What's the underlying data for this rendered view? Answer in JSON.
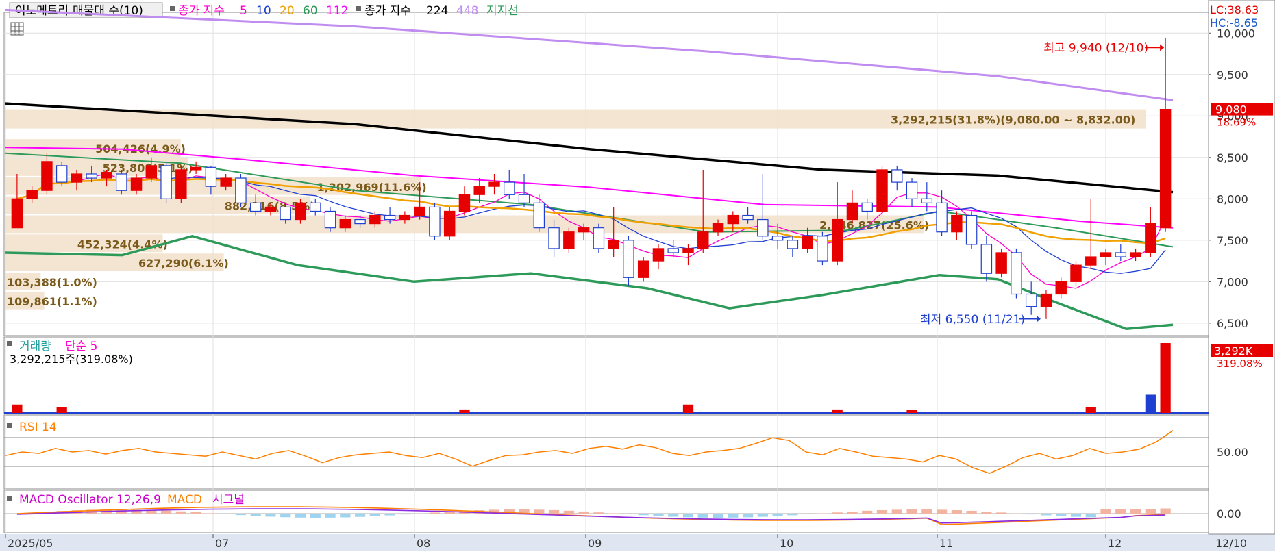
{
  "chart_data": {
    "type": "candlestick",
    "title": "이노메트리",
    "x_dates": [
      "2025/05",
      "07",
      "08",
      "09",
      "10",
      "11",
      "12"
    ],
    "x_current_label": "12/10",
    "legend_main": {
      "volume_profile": "매물대 수(10)",
      "ma_prefix": "종가 지수",
      "ma_periods": [
        "5",
        "10",
        "20",
        "60",
        "112"
      ],
      "ma_long_prefix": "종가 지수",
      "ma_long_periods": [
        "224",
        "448"
      ],
      "support_label": "지지선"
    },
    "lc_label": "LC:38.63",
    "hc_label": "HC:-8.65",
    "price_axis": {
      "min": 6350,
      "max": 10250,
      "ticks": [
        10000,
        9500,
        9000,
        8500,
        8000,
        7500,
        7000,
        6500
      ],
      "tick_labels": [
        "10,000",
        "9,500",
        "9,000",
        "8,500",
        "8,000",
        "7,500",
        "7,000",
        "6,500"
      ]
    },
    "current_price": {
      "value": 9080,
      "label": "9,080",
      "change_label": "18.69%"
    },
    "high_annotation": "최고 9,940 (12/10)",
    "low_annotation": "최저 6,550 (11/21)",
    "volume_profile": [
      {
        "label": "3,292,215(31.8%)(9,080.00 ~ 8,832.00)",
        "price_low": 8832,
        "price_high": 9080,
        "pct": 31.8
      },
      {
        "label": "504,426(4.9%)",
        "price_low": 8490,
        "price_high": 8720,
        "pct": 4.9
      },
      {
        "label": "523,808(5.1%)",
        "price_low": 8260,
        "price_high": 8490,
        "pct": 5.1
      },
      {
        "label": "1,202,969(11.6%)",
        "price_low": 8030,
        "price_high": 8260,
        "pct": 11.6
      },
      {
        "label": "882,116(8.5%)",
        "price_low": 7800,
        "price_high": 8030,
        "pct": 8.5
      },
      {
        "label": "2,646,827(25.6%)",
        "price_low": 7570,
        "price_high": 7800,
        "pct": 25.6
      },
      {
        "label": "452,324(4.4%)",
        "price_low": 7340,
        "price_high": 7570,
        "pct": 4.4
      },
      {
        "label": "627,290(6.1%)",
        "price_low": 7110,
        "price_high": 7340,
        "pct": 6.1
      },
      {
        "label": "103,388(1.0%)",
        "price_low": 6880,
        "price_high": 7110,
        "pct": 1.0
      },
      {
        "label": "109,861(1.1%)",
        "price_low": 6650,
        "price_high": 6880,
        "pct": 1.1
      }
    ],
    "ma_series": [
      {
        "name": "448",
        "color": "#c08cf0",
        "points": [
          [
            0,
            10280
          ],
          [
            0.3,
            10080
          ],
          [
            0.6,
            9780
          ],
          [
            0.85,
            9480
          ],
          [
            1,
            9190
          ]
        ]
      },
      {
        "name": "224",
        "color": "#000000",
        "points": [
          [
            0,
            9150
          ],
          [
            0.3,
            8900
          ],
          [
            0.5,
            8600
          ],
          [
            0.7,
            8350
          ],
          [
            0.85,
            8280
          ],
          [
            1,
            8080
          ]
        ]
      },
      {
        "name": "112",
        "color": "#ff00ff",
        "points": [
          [
            0,
            8620
          ],
          [
            0.1,
            8600
          ],
          [
            0.2,
            8480
          ],
          [
            0.35,
            8280
          ],
          [
            0.5,
            8140
          ],
          [
            0.65,
            7930
          ],
          [
            0.8,
            7900
          ],
          [
            0.92,
            7730
          ],
          [
            1,
            7650
          ]
        ]
      },
      {
        "name": "60",
        "color": "#2e9a5a",
        "points": [
          [
            0,
            8550
          ],
          [
            0.15,
            8430
          ],
          [
            0.3,
            8100
          ],
          [
            0.45,
            7930
          ],
          [
            0.6,
            7600
          ],
          [
            0.72,
            7620
          ],
          [
            0.8,
            7850
          ],
          [
            0.9,
            7650
          ],
          [
            1,
            7420
          ]
        ]
      },
      {
        "name": "support",
        "color": "#2e9a5a",
        "points": [
          [
            0,
            7350
          ],
          [
            0.1,
            7320
          ],
          [
            0.16,
            7550
          ],
          [
            0.25,
            7200
          ],
          [
            0.35,
            7000
          ],
          [
            0.45,
            7100
          ],
          [
            0.55,
            6920
          ],
          [
            0.62,
            6680
          ],
          [
            0.7,
            6840
          ],
          [
            0.8,
            7080
          ],
          [
            0.85,
            7030
          ],
          [
            0.9,
            6750
          ],
          [
            0.96,
            6430
          ],
          [
            1,
            6480
          ]
        ]
      }
    ],
    "candles": [
      [
        7650,
        8300,
        7650,
        8000
      ],
      [
        8000,
        8150,
        7950,
        8100
      ],
      [
        8100,
        8550,
        8050,
        8450
      ],
      [
        8400,
        8450,
        8150,
        8200
      ],
      [
        8200,
        8350,
        8100,
        8300
      ],
      [
        8300,
        8400,
        8200,
        8250
      ],
      [
        8250,
        8350,
        8150,
        8320
      ],
      [
        8300,
        8350,
        8050,
        8100
      ],
      [
        8100,
        8300,
        8050,
        8250
      ],
      [
        8250,
        8500,
        8200,
        8400
      ],
      [
        8400,
        8450,
        7950,
        8000
      ],
      [
        8000,
        8400,
        7950,
        8350
      ],
      [
        8350,
        8450,
        8300,
        8380
      ],
      [
        8380,
        8400,
        8050,
        8150
      ],
      [
        8150,
        8300,
        8100,
        8250
      ],
      [
        8250,
        8300,
        7900,
        7950
      ],
      [
        7950,
        8050,
        7800,
        7850
      ],
      [
        7850,
        7950,
        7800,
        7900
      ],
      [
        7900,
        7950,
        7700,
        7750
      ],
      [
        7750,
        8000,
        7700,
        7950
      ],
      [
        7950,
        8000,
        7800,
        7850
      ],
      [
        7850,
        7900,
        7600,
        7650
      ],
      [
        7650,
        7800,
        7600,
        7750
      ],
      [
        7750,
        7800,
        7650,
        7700
      ],
      [
        7700,
        7850,
        7650,
        7800
      ],
      [
        7800,
        7900,
        7700,
        7750
      ],
      [
        7750,
        7850,
        7700,
        7800
      ],
      [
        7800,
        8200,
        7750,
        7900
      ],
      [
        7900,
        7950,
        7500,
        7550
      ],
      [
        7550,
        7900,
        7500,
        7850
      ],
      [
        7850,
        8150,
        7800,
        8050
      ],
      [
        8050,
        8250,
        7950,
        8150
      ],
      [
        8150,
        8300,
        8050,
        8200
      ],
      [
        8200,
        8350,
        8000,
        8050
      ],
      [
        8050,
        8300,
        7900,
        7950
      ],
      [
        7950,
        8050,
        7600,
        7650
      ],
      [
        7650,
        7750,
        7300,
        7400
      ],
      [
        7400,
        7650,
        7350,
        7600
      ],
      [
        7600,
        7700,
        7500,
        7650
      ],
      [
        7650,
        7700,
        7350,
        7400
      ],
      [
        7400,
        7900,
        7300,
        7500
      ],
      [
        7500,
        7550,
        6950,
        7050
      ],
      [
        7050,
        7300,
        7000,
        7250
      ],
      [
        7250,
        7450,
        7150,
        7400
      ],
      [
        7400,
        7500,
        7300,
        7350
      ],
      [
        7350,
        7450,
        7200,
        7400
      ],
      [
        7400,
        8350,
        7350,
        7600
      ],
      [
        7600,
        7750,
        7550,
        7700
      ],
      [
        7700,
        7850,
        7600,
        7800
      ],
      [
        7800,
        7900,
        7700,
        7750
      ],
      [
        7750,
        8300,
        7500,
        7550
      ],
      [
        7550,
        7700,
        7400,
        7500
      ],
      [
        7500,
        7550,
        7300,
        7400
      ],
      [
        7400,
        7650,
        7350,
        7550
      ],
      [
        7550,
        7600,
        7200,
        7250
      ],
      [
        7250,
        8200,
        7200,
        7750
      ],
      [
        7750,
        8100,
        7700,
        7950
      ],
      [
        7950,
        8000,
        7750,
        7850
      ],
      [
        7850,
        8400,
        7800,
        8350
      ],
      [
        8350,
        8400,
        8100,
        8200
      ],
      [
        8200,
        8250,
        7900,
        8000
      ],
      [
        8000,
        8200,
        7850,
        7950
      ],
      [
        7950,
        8100,
        7550,
        7600
      ],
      [
        7600,
        7850,
        7500,
        7800
      ],
      [
        7800,
        7850,
        7400,
        7450
      ],
      [
        7450,
        7550,
        7000,
        7100
      ],
      [
        7100,
        7400,
        7050,
        7350
      ],
      [
        7350,
        7400,
        6800,
        6850
      ],
      [
        6850,
        7000,
        6600,
        6700
      ],
      [
        6700,
        6900,
        6550,
        6850
      ],
      [
        6850,
        7050,
        6800,
        7000
      ],
      [
        7000,
        7250,
        6950,
        7200
      ],
      [
        7200,
        8000,
        7150,
        7300
      ],
      [
        7300,
        7400,
        7200,
        7350
      ],
      [
        7350,
        7450,
        7250,
        7300
      ],
      [
        7300,
        7400,
        7250,
        7350
      ],
      [
        7350,
        7900,
        7300,
        7700
      ],
      [
        7650,
        9940,
        7600,
        9080
      ]
    ],
    "volume": {
      "label": "거래량",
      "ma_label": "단순 5",
      "current_text": "3,292,215주(319.08%)",
      "axis_label": "3,292K",
      "change_label": "319.08%",
      "spikes": [
        [
          0,
          0.12
        ],
        [
          3,
          0.08
        ],
        [
          30,
          0.05
        ],
        [
          45,
          0.12
        ],
        [
          55,
          0.05
        ],
        [
          60,
          0.04
        ],
        [
          72,
          0.08
        ],
        [
          76,
          0.26
        ],
        [
          77,
          1.0
        ]
      ]
    },
    "rsi": {
      "label": "RSI 14",
      "axis_label": "50.00",
      "values": [
        45,
        50,
        48,
        55,
        50,
        52,
        47,
        52,
        55,
        50,
        48,
        46,
        44,
        50,
        45,
        40,
        48,
        52,
        44,
        35,
        42,
        46,
        48,
        50,
        45,
        42,
        48,
        40,
        30,
        38,
        45,
        46,
        50,
        52,
        48,
        55,
        58,
        54,
        60,
        56,
        48,
        45,
        50,
        52,
        55,
        62,
        70,
        66,
        50,
        46,
        55,
        50,
        44,
        42,
        40,
        36,
        45,
        40,
        28,
        20,
        30,
        42,
        48,
        40,
        45,
        55,
        48,
        50,
        54,
        64,
        80
      ]
    },
    "macd": {
      "label": "MACD Oscillator 12,26,9",
      "macd_label": "MACD",
      "signal_label": "시그널",
      "axis_label": "0.00"
    }
  }
}
